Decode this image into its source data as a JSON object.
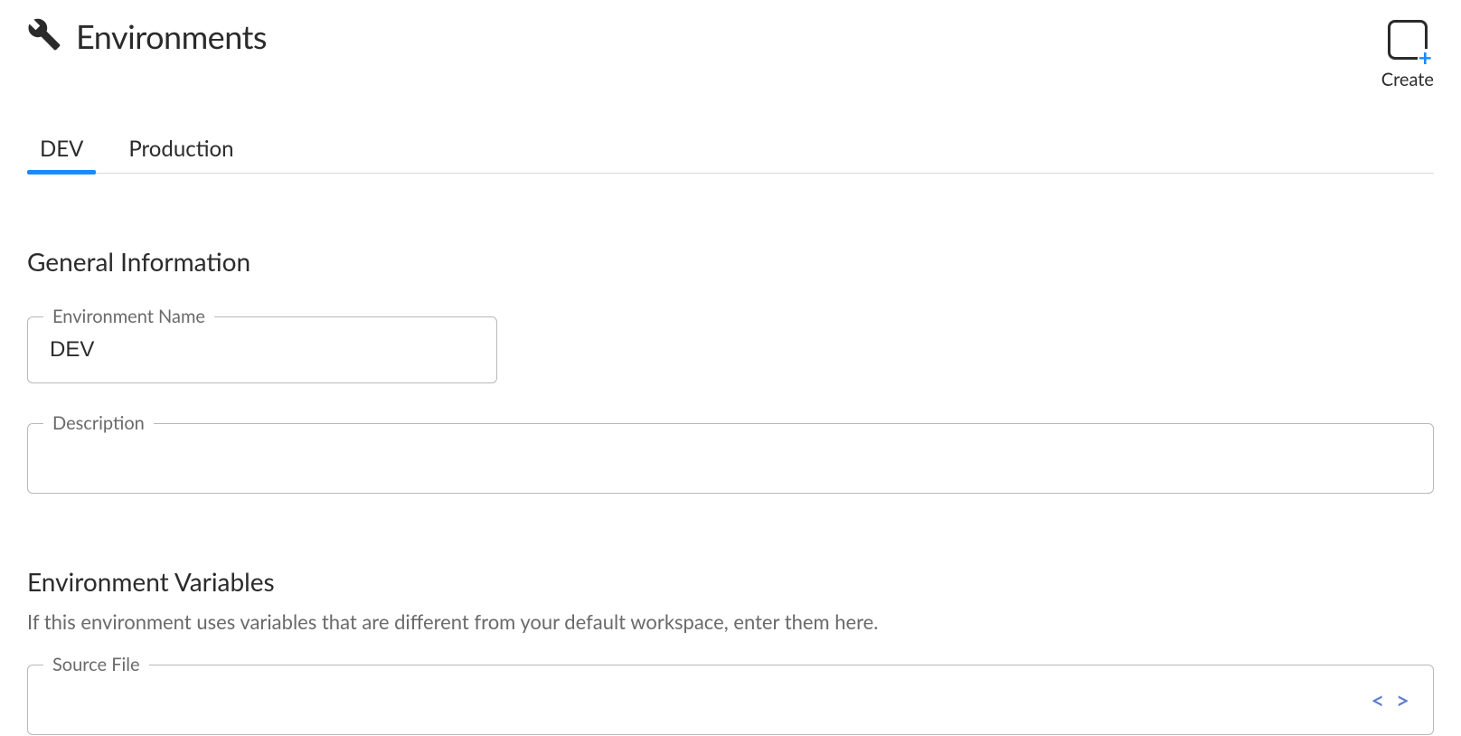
{
  "header": {
    "title": "Environments",
    "create_label": "Create"
  },
  "tabs": [
    {
      "id": "dev",
      "label": "DEV",
      "active": true
    },
    {
      "id": "production",
      "label": "Production",
      "active": false
    }
  ],
  "sections": {
    "general": {
      "heading": "General Information",
      "fields": {
        "env_name": {
          "label": "Environment Name",
          "value": "DEV"
        },
        "description": {
          "label": "Description",
          "value": ""
        }
      }
    },
    "variables": {
      "heading": "Environment Variables",
      "help": "If this environment uses variables that are different from your default workspace, enter them here.",
      "fields": {
        "source_file": {
          "label": "Source File",
          "value": ""
        }
      }
    }
  }
}
